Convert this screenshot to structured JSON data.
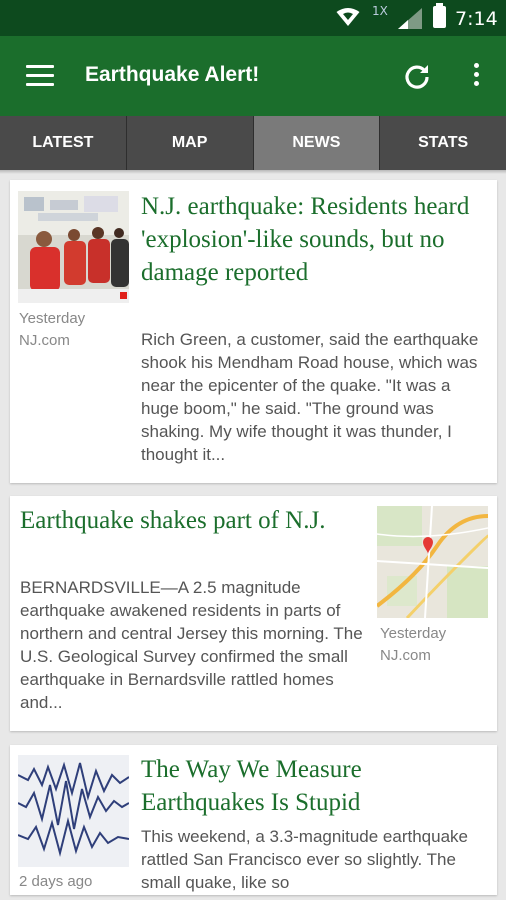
{
  "status_bar": {
    "network_label": "1X",
    "time": "7:14"
  },
  "app_bar": {
    "title": "Earthquake Alert!"
  },
  "tabs": [
    {
      "label": "LATEST",
      "active": false
    },
    {
      "label": "MAP",
      "active": false
    },
    {
      "label": "NEWS",
      "active": true
    },
    {
      "label": "STATS",
      "active": false
    }
  ],
  "articles": [
    {
      "headline": "N.J. earthquake: Residents heard 'explosion'-like sounds, but no damage reported",
      "snippet": "Rich Green, a customer, said the earthquake shook his Mendham Road house, which was near the epicenter of the quake. \"It was a huge boom,\" he said. \"The ground was shaking. My wife thought it was thunder, I thought it...",
      "time": "Yesterday",
      "source": "NJ.com",
      "thumbnail": "people-photo"
    },
    {
      "headline": "Earthquake shakes part of N.J.",
      "snippet": "BERNARDSVILLE—A 2.5 magnitude earthquake awakened residents in parts of northern and central Jersey this morning. The U.S. Geological Survey confirmed the small earthquake in Bernardsville rattled homes and...",
      "time": "Yesterday",
      "source": "NJ.com",
      "thumbnail": "map"
    },
    {
      "headline": "The Way We Measure Earthquakes Is Stupid",
      "snippet": "This weekend, a 3.3-magnitude earthquake rattled San Francisco ever so slightly. The small quake, like so",
      "time": "2 days ago",
      "source": "",
      "thumbnail": "seismogram"
    }
  ],
  "colors": {
    "status_bar": "#0d4a1e",
    "app_bar": "#1b6e2c",
    "tab_bar": "#4a4a4a",
    "tab_active": "#7a7a7a",
    "headline": "#1b6e2c"
  }
}
